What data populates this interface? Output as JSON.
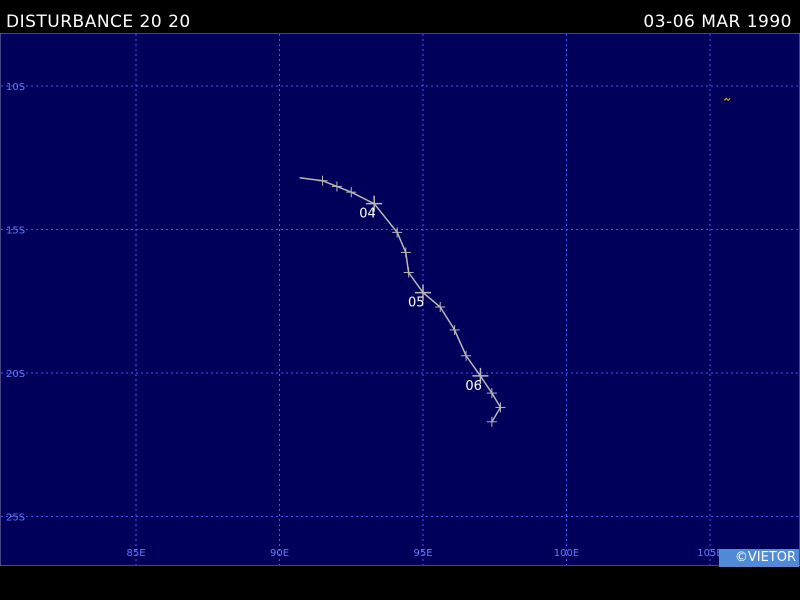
{
  "header": {
    "title": "DISTURBANCE 20 20",
    "date_range": "03-06 MAR 1990"
  },
  "map": {
    "background_color": "#00005a",
    "grid_color": "#4a56ff",
    "label_color": "#6878ff",
    "track_color": "#b8b8b8",
    "lat_lines": [
      {
        "label": "10S",
        "lat": -10
      },
      {
        "label": "15S",
        "lat": -15
      },
      {
        "label": "20S",
        "lat": -20
      },
      {
        "label": "25S",
        "lat": -25
      }
    ],
    "lon_lines": [
      {
        "label": "85E",
        "lon": 85
      },
      {
        "label": "90E",
        "lon": 90
      },
      {
        "label": "95E",
        "lon": 95
      },
      {
        "label": "100E",
        "lon": 100
      },
      {
        "label": "105E",
        "lon": 105
      }
    ],
    "track": [
      {
        "lon": 90.7,
        "lat": -13.2
      },
      {
        "lon": 91.5,
        "lat": -13.3
      },
      {
        "lon": 92.0,
        "lat": -13.5
      },
      {
        "lon": 92.5,
        "lat": -13.7
      },
      {
        "lon": 93.3,
        "lat": -14.1
      },
      {
        "lon": 94.1,
        "lat": -15.1
      },
      {
        "lon": 94.4,
        "lat": -15.8
      },
      {
        "lon": 94.5,
        "lat": -16.5
      },
      {
        "lon": 95.0,
        "lat": -17.2
      },
      {
        "lon": 95.6,
        "lat": -17.7
      },
      {
        "lon": 96.1,
        "lat": -18.5
      },
      {
        "lon": 96.5,
        "lat": -19.4
      },
      {
        "lon": 97.0,
        "lat": -20.1
      },
      {
        "lon": 97.4,
        "lat": -20.7
      },
      {
        "lon": 97.7,
        "lat": -21.2
      },
      {
        "lon": 97.4,
        "lat": -21.7
      }
    ],
    "fixes": [
      {
        "lon": 91.5,
        "lat": -13.3
      },
      {
        "lon": 92.0,
        "lat": -13.5
      },
      {
        "lon": 92.5,
        "lat": -13.7
      },
      {
        "lon": 94.1,
        "lat": -15.1
      },
      {
        "lon": 94.4,
        "lat": -15.8
      },
      {
        "lon": 94.5,
        "lat": -16.5
      },
      {
        "lon": 95.6,
        "lat": -17.7
      },
      {
        "lon": 96.1,
        "lat": -18.5
      },
      {
        "lon": 96.5,
        "lat": -19.4
      },
      {
        "lon": 97.4,
        "lat": -20.7
      },
      {
        "lon": 97.7,
        "lat": -21.2
      },
      {
        "lon": 97.4,
        "lat": -21.7
      }
    ],
    "day_markers": [
      {
        "label": "04",
        "lon": 93.3,
        "lat": -14.1
      },
      {
        "label": "05",
        "lon": 95.0,
        "lat": -17.2
      },
      {
        "label": "06",
        "lon": 97.0,
        "lat": -20.1
      }
    ],
    "small_mark": {
      "lon": 105.6,
      "lat": -10.5
    }
  },
  "copyright": "©VIETOR"
}
